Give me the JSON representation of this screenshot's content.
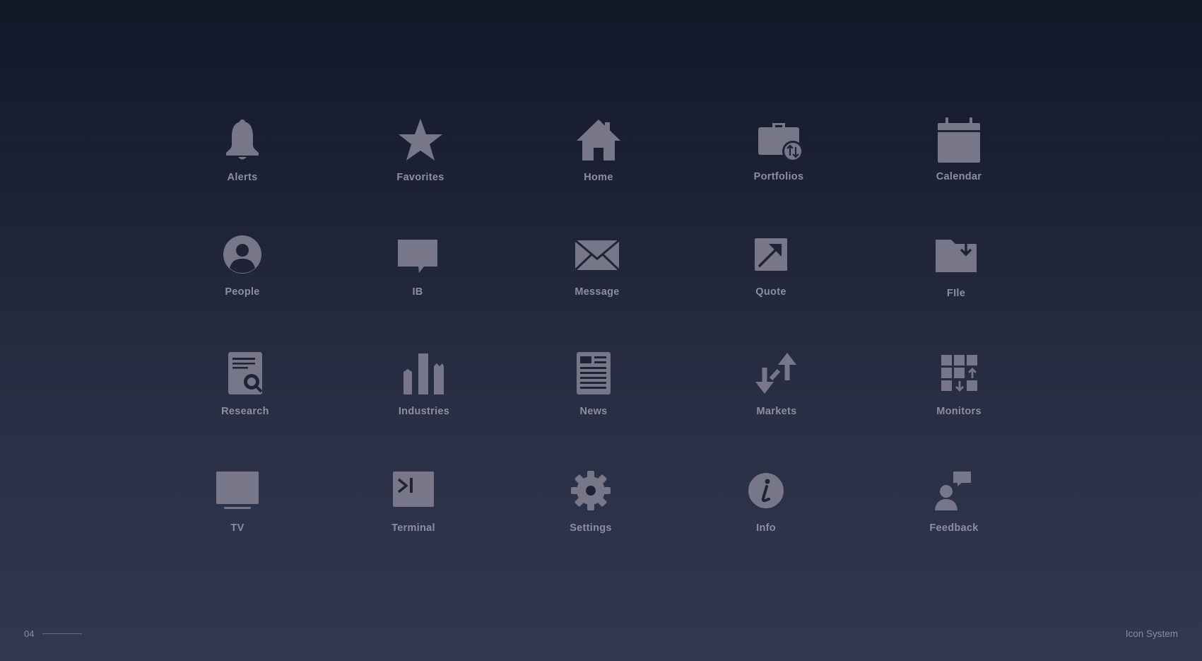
{
  "colors": {
    "icon": "#777789",
    "label": "#8e8ea0",
    "background_top": "#121728",
    "background_bottom": "#313851"
  },
  "icons": [
    {
      "label": "Alerts",
      "icon": "bell-icon"
    },
    {
      "label": "Favorites",
      "icon": "star-icon"
    },
    {
      "label": "Home",
      "icon": "home-icon"
    },
    {
      "label": "Portfolios",
      "icon": "briefcase-icon"
    },
    {
      "label": "Calendar",
      "icon": "calendar-icon"
    },
    {
      "label": "People",
      "icon": "person-icon"
    },
    {
      "label": "IB",
      "icon": "speech-bubble-icon"
    },
    {
      "label": "Message",
      "icon": "envelope-icon"
    },
    {
      "label": "Quote",
      "icon": "arrow-box-icon"
    },
    {
      "label": "FIle",
      "icon": "folder-download-icon"
    },
    {
      "label": "Research",
      "icon": "document-search-icon"
    },
    {
      "label": "Industries",
      "icon": "bar-chart-icon"
    },
    {
      "label": "News",
      "icon": "newspaper-icon"
    },
    {
      "label": "Markets",
      "icon": "up-down-arrows-icon"
    },
    {
      "label": "Monitors",
      "icon": "grid-arrows-icon"
    },
    {
      "label": "TV",
      "icon": "monitor-icon"
    },
    {
      "label": "Terminal",
      "icon": "terminal-icon"
    },
    {
      "label": "Settings",
      "icon": "gear-icon"
    },
    {
      "label": "Info",
      "icon": "info-icon"
    },
    {
      "label": "Feedback",
      "icon": "feedback-icon"
    }
  ],
  "footer": {
    "page_number": "04",
    "title": "Icon System"
  }
}
